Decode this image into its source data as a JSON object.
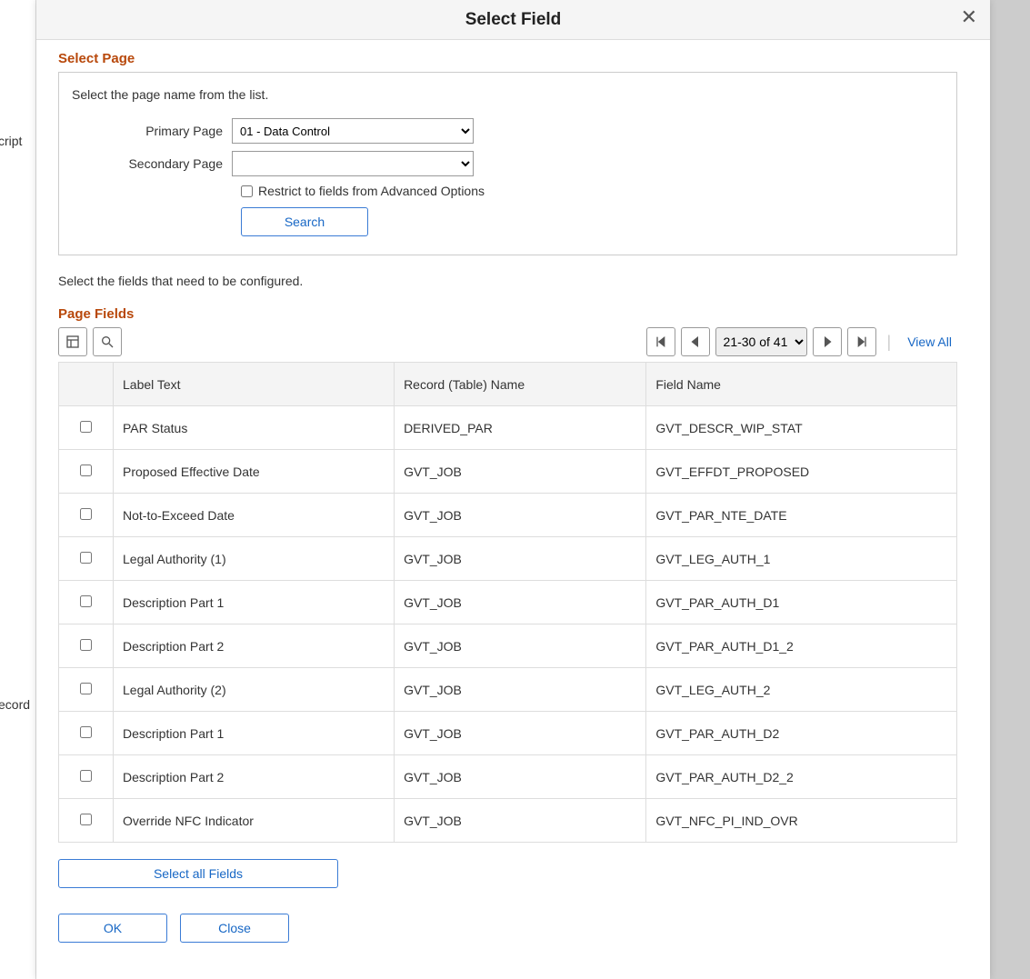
{
  "background": {
    "label1": "cript",
    "label2": "ecord"
  },
  "modal": {
    "title": "Select Field",
    "close_aria": "Close"
  },
  "select_page": {
    "title": "Select Page",
    "description": "Select the page name from the list.",
    "primary_label": "Primary Page",
    "primary_value": "01 - Data Control",
    "secondary_label": "Secondary Page",
    "secondary_value": "",
    "restrict_label": "Restrict to fields from Advanced Options",
    "restrict_checked": false,
    "search_label": "Search"
  },
  "instruction": "Select the fields that need to be configured.",
  "page_fields": {
    "title": "Page Fields",
    "pager_label": "21-30 of 41",
    "view_all": "View All",
    "columns": {
      "c0": "",
      "c1": "Label Text",
      "c2": "Record (Table) Name",
      "c3": "Field Name"
    },
    "rows": [
      {
        "label": "PAR Status",
        "record": "DERIVED_PAR",
        "field": "GVT_DESCR_WIP_STAT"
      },
      {
        "label": "Proposed Effective Date",
        "record": "GVT_JOB",
        "field": "GVT_EFFDT_PROPOSED"
      },
      {
        "label": "Not-to-Exceed Date",
        "record": "GVT_JOB",
        "field": "GVT_PAR_NTE_DATE"
      },
      {
        "label": "Legal Authority (1)",
        "record": "GVT_JOB",
        "field": "GVT_LEG_AUTH_1"
      },
      {
        "label": "Description Part 1",
        "record": "GVT_JOB",
        "field": "GVT_PAR_AUTH_D1"
      },
      {
        "label": "Description Part 2",
        "record": "GVT_JOB",
        "field": "GVT_PAR_AUTH_D1_2"
      },
      {
        "label": "Legal Authority (2)",
        "record": "GVT_JOB",
        "field": "GVT_LEG_AUTH_2"
      },
      {
        "label": "Description Part 1",
        "record": "GVT_JOB",
        "field": "GVT_PAR_AUTH_D2"
      },
      {
        "label": "Description Part 2",
        "record": "GVT_JOB",
        "field": "GVT_PAR_AUTH_D2_2"
      },
      {
        "label": "Override NFC Indicator",
        "record": "GVT_JOB",
        "field": "GVT_NFC_PI_IND_OVR"
      }
    ]
  },
  "footer": {
    "select_all": "Select all Fields",
    "ok": "OK",
    "close": "Close"
  }
}
